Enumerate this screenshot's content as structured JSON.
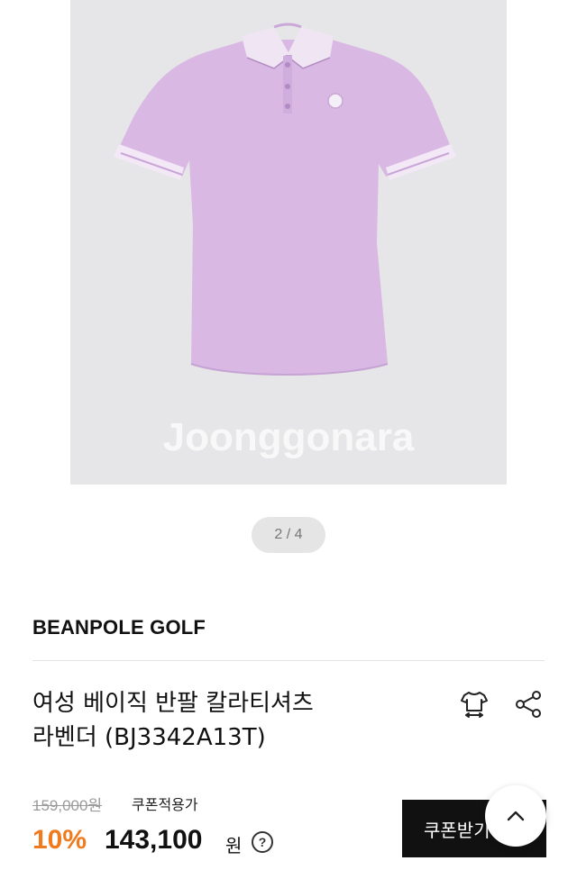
{
  "gallery": {
    "image_alt": "lavender short-sleeve polo shirt",
    "watermark_text": "Joonggonara",
    "page_indicator": "2 / 4"
  },
  "product": {
    "brand": "BEANPOLE GOLF",
    "title_line1": "여성 베이직 반팔 칼라티셔츠",
    "title_line2": "라벤더 (BJ3342A13T)",
    "original_price": "159,000원",
    "coupon_applied_label": "쿠폰적용가",
    "discount_rate": "10%",
    "price": "143,100",
    "currency": "원"
  },
  "actions": {
    "coupon_button_label": "쿠폰받기",
    "size_icon": "tshirt-size-icon",
    "share_icon": "share-icon",
    "scroll_top_icon": "chevron-up-icon",
    "help_icon": "question-circle-icon"
  },
  "colors": {
    "discount": "#f07a1e",
    "shirt": "#d9b8e4",
    "gallery_bg": "#e6e6e8",
    "coupon_button_bg": "#111111"
  }
}
